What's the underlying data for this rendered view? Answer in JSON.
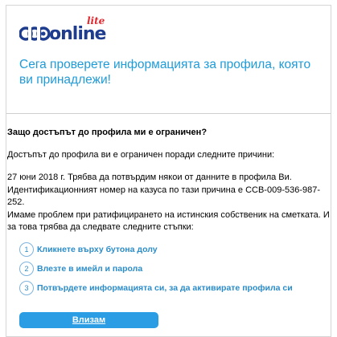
{
  "logo": {
    "brand": "online",
    "tag": "lite"
  },
  "header": {
    "title": "Сега проверете информацията за профила, която ви принадлежи!"
  },
  "content": {
    "question": "Защо достъпът до профила ми е ограничен?",
    "intro": "Достъпът до профила ви е ограничен поради следните причини:",
    "details": [
      "27 юни 2018 г. Трябва да потвърдим някои от данните в профила Ви.",
      "Идентификационният номер на казуса по тази причина е CCB-009-536-987-252.",
      "Имаме проблем при ратифицирането на истинския собственик на сметката. И за това трябва да следвате следните стъпки:"
    ]
  },
  "steps": [
    {
      "num": "1",
      "label": "Кликнете върху бутона долу"
    },
    {
      "num": "2",
      "label": "Влезте в имейл и парола"
    },
    {
      "num": "3",
      "label": "Потвърдете информацията си, за да активирате профила си"
    }
  ],
  "action": {
    "button_label": "Влизам"
  },
  "colors": {
    "accent": "#1f9bd8",
    "button": "#2b9de4",
    "brand": "#1e3d8f",
    "lite": "#e0262e"
  }
}
